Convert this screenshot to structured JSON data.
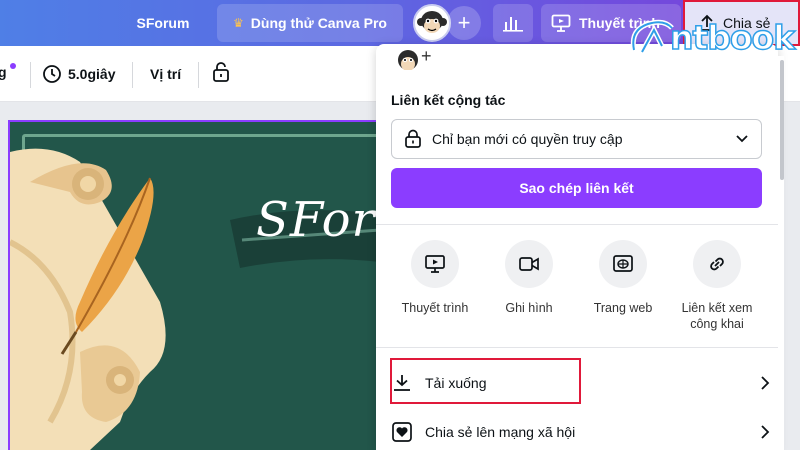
{
  "topbar": {
    "design_title": "SForum",
    "pro_trial": "Dùng thử Canva Pro",
    "add": "+",
    "present": "Thuyết trình",
    "share": "Chia sẻ"
  },
  "watermark": {
    "text": "ntbook"
  },
  "toolbar": {
    "partial_label": "g",
    "duration": "5.0giây",
    "position": "Vị trí"
  },
  "canvas": {
    "design_text": "SForum"
  },
  "share_panel": {
    "add": "+",
    "collab_heading": "Liên kết cộng tác",
    "access_value": "Chỉ bạn mới có quyền truy cập",
    "copy_link": "Sao chép liên kết",
    "options": [
      {
        "label": "Thuyết trình",
        "icon": "present-icon"
      },
      {
        "label": "Ghi hình",
        "icon": "video-camera-icon"
      },
      {
        "label": "Trang web",
        "icon": "website-icon"
      },
      {
        "label_line1": "Liên kết xem",
        "label_line2": "công khai",
        "icon": "link-icon"
      }
    ],
    "download": "Tải xuống",
    "share_social": "Chia sẻ lên mạng xã hội"
  },
  "colors": {
    "accent": "#8b3dff",
    "highlight_red": "#e0193a",
    "design_bg": "#22564a"
  }
}
